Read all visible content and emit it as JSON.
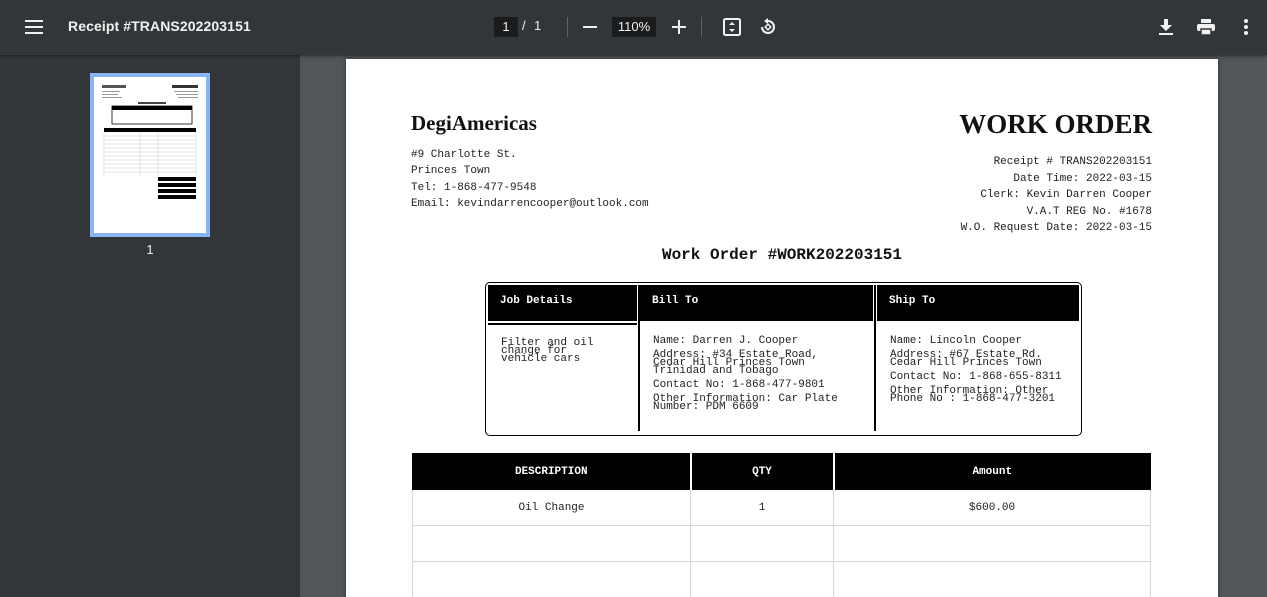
{
  "toolbar": {
    "title": "Receipt #TRANS202203151",
    "current_page": "1",
    "page_separator": "/",
    "total_pages": "1",
    "zoom": "110%"
  },
  "sidebar": {
    "thumbnail_label": "1"
  },
  "document": {
    "company": "DegiAmericas",
    "address_lines": [
      "#9 Charlotte St.",
      "Princes Town",
      "Tel: 1-868-477-9548",
      "Email: kevindarrencooper@outlook.com"
    ],
    "heading": "WORK ORDER",
    "meta_lines": [
      "Receipt # TRANS202203151",
      "Date Time: 2022-03-15",
      "Clerk: Kevin Darren Cooper",
      "V.A.T REG No. #1678",
      "W.O. Request Date: 2022-03-15"
    ],
    "work_order_number": "Work Order #WORK202203151",
    "job_details_header": "Job Details",
    "bill_to_header": "Bill To",
    "ship_to_header": "Ship To",
    "job_details_lines": [
      "Filter and oil",
      "change for",
      "vehicle cars"
    ],
    "bill_to": {
      "name": "Name: Darren J. Cooper",
      "address_lines": [
        "Address: #34 Estate Road,",
        "Cedar Hill Princes Town",
        "Trinidad and Tobago"
      ],
      "contact": "Contact No: 1-868-477-9801",
      "other_lines": [
        "Other Information: Car Plate",
        "Number: PDM 6609"
      ]
    },
    "ship_to": {
      "name": "Name: Lincoln Cooper",
      "address_lines": [
        "Address: #67 Estate Rd.",
        "Cedar Hill Princes Town"
      ],
      "contact": "Contact No: 1-868-655-8311",
      "other_lines": [
        "Other Information: Other",
        "Phone No : 1-868-477-3201"
      ]
    },
    "table": {
      "headers": [
        "DESCRIPTION",
        "QTY",
        "Amount"
      ],
      "rows": [
        [
          "Oil Change",
          "1",
          "$600.00"
        ],
        [
          "",
          "",
          ""
        ],
        [
          "",
          "",
          ""
        ]
      ]
    }
  }
}
